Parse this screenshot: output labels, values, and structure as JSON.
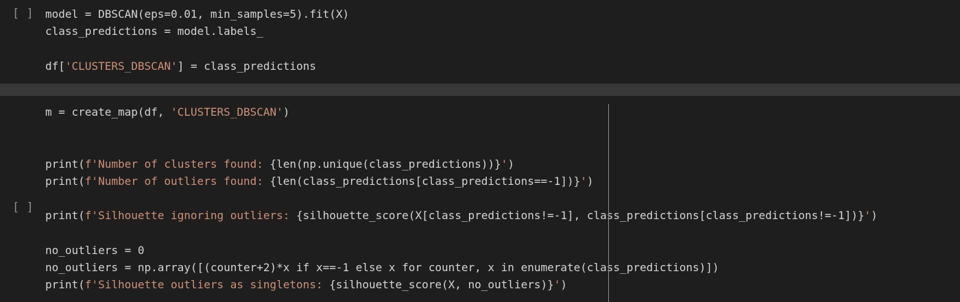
{
  "cells": [
    {
      "run_indicator": "[ ]",
      "lines": [
        [
          {
            "t": "model = DBSCAN(eps=0.01, min_samples=5).fit(X)",
            "c": ""
          }
        ],
        [
          {
            "t": "class_predictions = model.labels_",
            "c": ""
          }
        ],
        [],
        [
          {
            "t": "df[",
            "c": ""
          },
          {
            "t": "'CLUSTERS_DBSCAN'",
            "c": "str"
          },
          {
            "t": "] = class_predictions",
            "c": ""
          }
        ]
      ]
    },
    {
      "run_indicator": "[ ]",
      "lines": [
        [
          {
            "t": "m = create_map(df, ",
            "c": ""
          },
          {
            "t": "'CLUSTERS_DBSCAN'",
            "c": "str"
          },
          {
            "t": ")",
            "c": ""
          }
        ],
        [],
        [],
        [
          {
            "t": "print(",
            "c": ""
          },
          {
            "t": "f'Number of clusters found: ",
            "c": "str"
          },
          {
            "t": "{len(np.unique(class_predictions))}",
            "c": ""
          },
          {
            "t": "'",
            "c": "str"
          },
          {
            "t": ")",
            "c": ""
          }
        ],
        [
          {
            "t": "print(",
            "c": ""
          },
          {
            "t": "f'Number of outliers found: ",
            "c": "str"
          },
          {
            "t": "{len(class_predictions[class_predictions==-1])}",
            "c": ""
          },
          {
            "t": "'",
            "c": "str"
          },
          {
            "t": ")",
            "c": ""
          }
        ],
        [],
        [
          {
            "t": "print(",
            "c": ""
          },
          {
            "t": "f'Silhouette ignoring outliers: ",
            "c": "str"
          },
          {
            "t": "{silhouette_score(X[class_predictions!=-1], class_predictions[class_predictions!=-1])}",
            "c": ""
          },
          {
            "t": "'",
            "c": "str"
          },
          {
            "t": ")",
            "c": ""
          }
        ],
        [],
        [
          {
            "t": "no_outliers = 0",
            "c": ""
          }
        ],
        [
          {
            "t": "no_outliers = np.array([(counter+2)*x if x==-1 else x for counter, x in enumerate(class_predictions)])",
            "c": ""
          }
        ],
        [
          {
            "t": "print(",
            "c": ""
          },
          {
            "t": "f'Silhouette outliers as singletons: ",
            "c": "str"
          },
          {
            "t": "{silhouette_score(X, no_outliers)}",
            "c": ""
          },
          {
            "t": "'",
            "c": "str"
          },
          {
            "t": ")",
            "c": ""
          }
        ]
      ]
    }
  ]
}
